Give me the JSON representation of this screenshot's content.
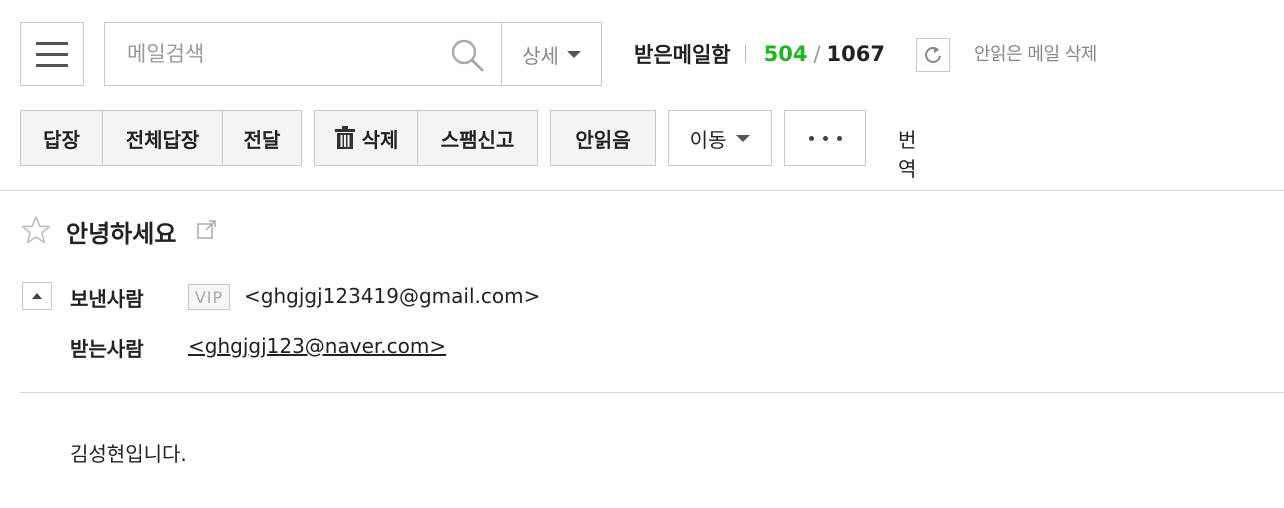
{
  "search": {
    "placeholder": "메일검색",
    "detail_label": "상세"
  },
  "mailbox": {
    "title": "받은메일함",
    "unread": "504",
    "slash": "/",
    "total": "1067",
    "delete_unread_label": "안읽은 메일 삭제"
  },
  "toolbar": {
    "reply": "답장",
    "reply_all": "전체답장",
    "forward": "전달",
    "delete": "삭제",
    "spam": "스팸신고",
    "mark_unread": "안읽음",
    "move": "이동",
    "translate": "번역"
  },
  "message": {
    "subject": "안녕하세요",
    "sender_label": "보낸사람",
    "vip_badge": "VIP",
    "sender_address": "<ghgjgj123419@gmail.com>",
    "receiver_label": "받는사람",
    "receiver_address": "<ghgjgj123@naver.com>",
    "body": "김성현입니다."
  },
  "colors": {
    "unread_count": "#1fb71f",
    "border": "#c8c8c8",
    "button_bg": "#f4f4f4"
  },
  "icons": [
    "menu-icon",
    "search-icon",
    "caret-down-icon",
    "refresh-icon",
    "trash-icon",
    "more-icon",
    "star-icon",
    "popout-icon",
    "collapse-icon"
  ]
}
